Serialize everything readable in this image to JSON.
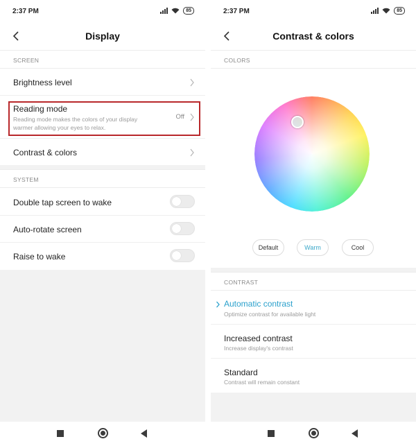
{
  "status": {
    "time": "2:37 PM",
    "battery": "85"
  },
  "left": {
    "title": "Display",
    "section_screen": "SCREEN",
    "brightness": "Brightness level",
    "reading_mode": {
      "label": "Reading mode",
      "sub_line1": "Reading mode makes the colors of your display",
      "sub_line2": "warmer allowing your eyes to relax.",
      "value": "Off"
    },
    "contrast": "Contrast & colors",
    "section_system": "SYSTEM",
    "double_tap": "Double tap screen to wake",
    "auto_rotate": "Auto-rotate screen",
    "raise_wake": "Raise to wake"
  },
  "right": {
    "title": "Contrast & colors",
    "section_colors": "COLORS",
    "presets": [
      "Default",
      "Warm",
      "Cool"
    ],
    "section_contrast": "CONTRAST",
    "options": [
      {
        "label": "Automatic contrast",
        "sub": "Optimize contrast for available light"
      },
      {
        "label": "Increased contrast",
        "sub": "Increase display's contrast"
      },
      {
        "label": "Standard",
        "sub": "Contrast will remain constant"
      }
    ]
  },
  "colors": {
    "highlight_border": "#b8272a",
    "accent": "#2aa0cc",
    "background_gray": "#f2f2f2"
  }
}
